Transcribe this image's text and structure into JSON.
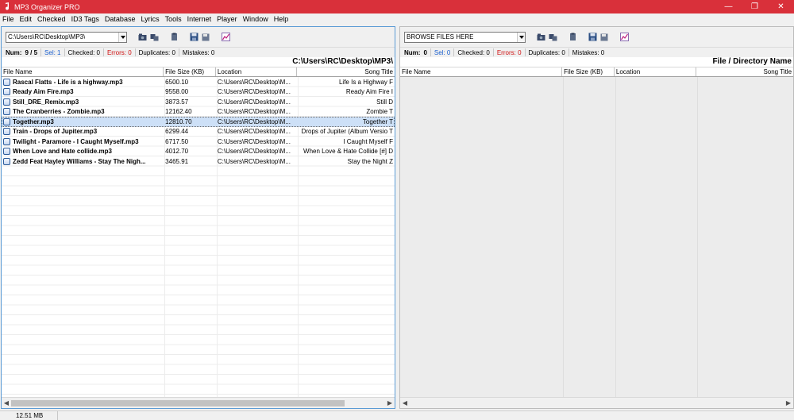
{
  "app": {
    "title": "MP3 Organizer PRO"
  },
  "window_controls": {
    "minimize": "—",
    "restore": "❐",
    "close": "✕"
  },
  "menu": [
    "File",
    "Edit",
    "Checked",
    "ID3 Tags",
    "Database",
    "Lyrics",
    "Tools",
    "Internet",
    "Player",
    "Window",
    "Help"
  ],
  "left": {
    "path_combo": "C:\\Users\\RC\\Desktop\\MP3\\",
    "status": {
      "num_label": "Num:",
      "num_value": "9 / 5",
      "sel": "Sel: 1",
      "checked": "Checked: 0",
      "errors": "Errors: 0",
      "duplicates": "Duplicates: 0",
      "mistakes": "Mistakes: 0"
    },
    "path_header": "C:\\Users\\RC\\Desktop\\MP3\\",
    "columns": [
      "File Name",
      "File Size (KB)",
      "Location",
      "Song Title"
    ],
    "rows": [
      {
        "name": "Rascal Flatts - Life is a highway.mp3",
        "size": "6500.10",
        "location": "C:\\Users\\RC\\Desktop\\M...",
        "title": "Life Is a Highway F",
        "selected": false
      },
      {
        "name": "Ready Aim Fire.mp3",
        "size": "9558.00",
        "location": "C:\\Users\\RC\\Desktop\\M...",
        "title": "Ready Aim Fire I",
        "selected": false
      },
      {
        "name": "Still_DRE_Remix.mp3",
        "size": "3873.57",
        "location": "C:\\Users\\RC\\Desktop\\M...",
        "title": "Still D",
        "selected": false
      },
      {
        "name": "The Cranberries - Zombie.mp3",
        "size": "12162.40",
        "location": "C:\\Users\\RC\\Desktop\\M...",
        "title": "Zombie T",
        "selected": false
      },
      {
        "name": "Together.mp3",
        "size": "12810.70",
        "location": "C:\\Users\\RC\\Desktop\\M...",
        "title": "Together T",
        "selected": true
      },
      {
        "name": "Train - Drops of Jupiter.mp3",
        "size": "6299.44",
        "location": "C:\\Users\\RC\\Desktop\\M...",
        "title": "Drops of Jupiter (Album Versio T",
        "selected": false
      },
      {
        "name": "Twilight - Paramore - I Caught Myself.mp3",
        "size": "6717.50",
        "location": "C:\\Users\\RC\\Desktop\\M...",
        "title": "I Caught Myself F",
        "selected": false
      },
      {
        "name": "When Love and Hate collide.mp3",
        "size": "4012.70",
        "location": "C:\\Users\\RC\\Desktop\\M...",
        "title": "When Love & Hate Collide [#] D",
        "selected": false
      },
      {
        "name": "Zedd Feat Hayley Williams - Stay The Nigh...",
        "size": "3465.91",
        "location": "C:\\Users\\RC\\Desktop\\M...",
        "title": "Stay the Night Z",
        "selected": false
      }
    ]
  },
  "right": {
    "path_combo": "BROWSE FILES HERE",
    "status": {
      "num_label": "Num:",
      "num_value": "0",
      "sel": "Sel: 0",
      "checked": "Checked: 0",
      "errors": "Errors: 0",
      "duplicates": "Duplicates: 0",
      "mistakes": "Mistakes: 0"
    },
    "path_header": "File / Directory Name",
    "columns": [
      "File Name",
      "File Size (KB)",
      "Location",
      "Song Title"
    ]
  },
  "statusbar": {
    "size": "12.51 MB"
  },
  "icons": [
    "music-note-icon",
    "folder-open-icon",
    "folder-copy-icon",
    "paste-icon",
    "save-icon",
    "save-all-icon",
    "chart-icon"
  ],
  "colors": {
    "titlebar": "#d9303a",
    "selected_row": "#cde0f7",
    "accent_blue": "#1a5fcf",
    "error_red": "#d01010"
  }
}
